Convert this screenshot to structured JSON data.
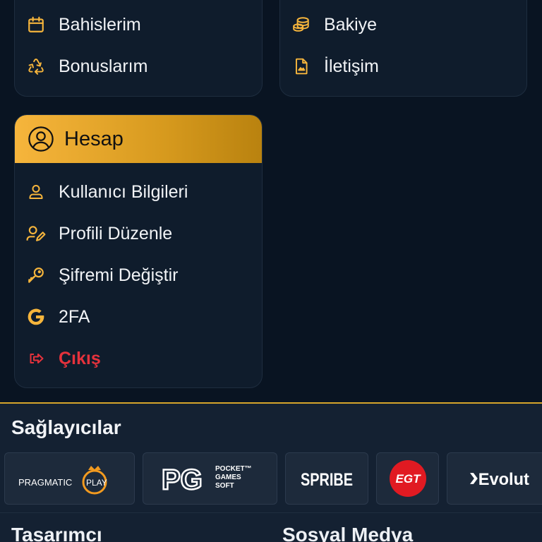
{
  "menu_top_left": {
    "items": [
      {
        "label": "Bahislerim",
        "icon": "calendar-icon"
      },
      {
        "label": "Bonuslarım",
        "icon": "recycle-icon"
      }
    ]
  },
  "menu_top_right": {
    "items": [
      {
        "label": "Bakiye",
        "icon": "coins-icon"
      },
      {
        "label": "İletişim",
        "icon": "document-icon"
      }
    ]
  },
  "account": {
    "title": "Hesap",
    "icon": "user-circle-icon",
    "items": [
      {
        "label": "Kullanıcı Bilgileri",
        "icon": "user-icon"
      },
      {
        "label": "Profili Düzenle",
        "icon": "user-edit-icon"
      },
      {
        "label": "Şifremi Değiştir",
        "icon": "key-icon"
      },
      {
        "label": "2FA",
        "icon": "google-icon"
      },
      {
        "label": "Çıkış",
        "icon": "logout-icon"
      }
    ]
  },
  "providers": {
    "title": "Sağlayıcılar",
    "items": [
      {
        "name": "PRAGMATIC PLAY",
        "part1": "PRAGMATIC",
        "part2": "PLAY"
      },
      {
        "name": "PG POCKET GAMES SOFT",
        "mark": "PG",
        "sub1": "POCKET™",
        "sub2": "GAMES",
        "sub3": "SOFT"
      },
      {
        "name": "SPRIBE"
      },
      {
        "name": "EGT"
      },
      {
        "name": "Evolut"
      }
    ]
  },
  "footer": {
    "design_title": "Tasarımcı",
    "social_title": "Sosyal Medya"
  },
  "colors": {
    "background": "#091422",
    "card": "#0f1c2c",
    "accent": "#f6b53c",
    "danger": "#e5323c",
    "provider_bg": "#1d2a3b"
  }
}
